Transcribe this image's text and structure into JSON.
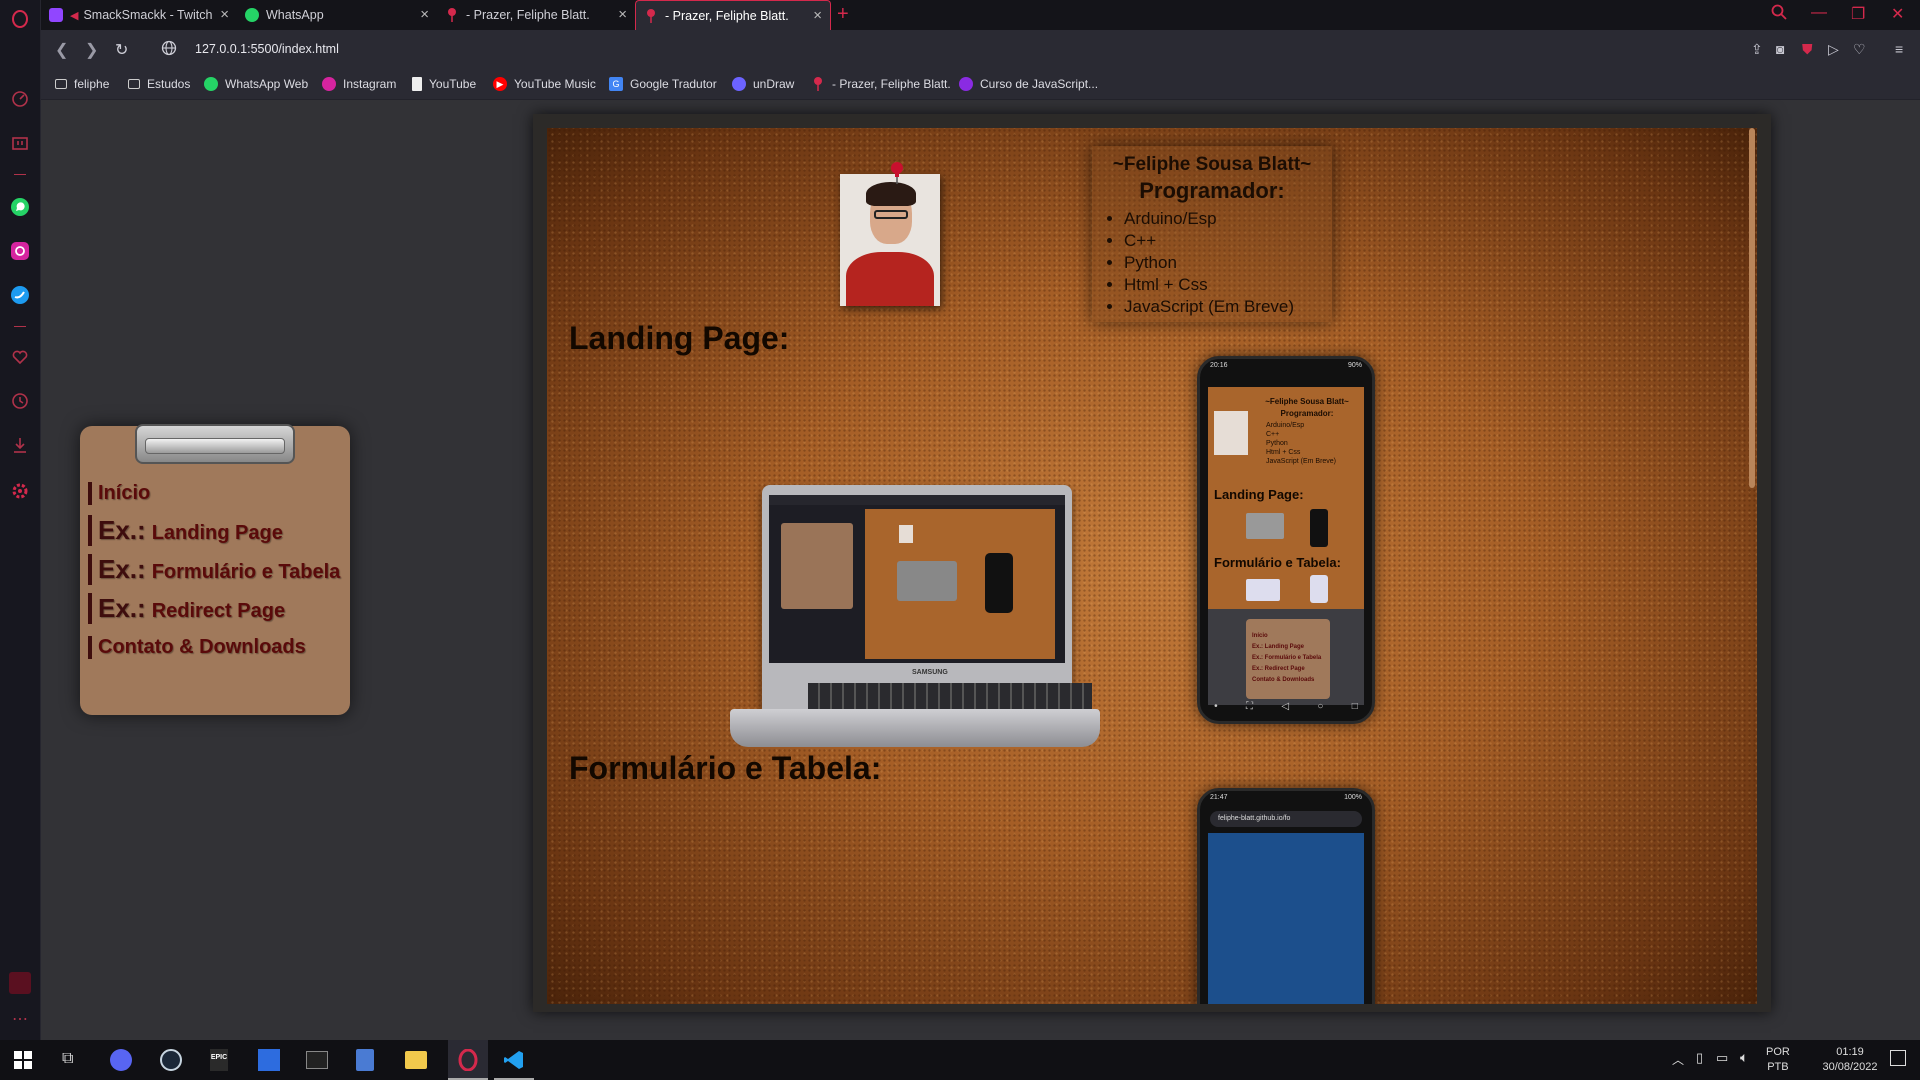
{
  "tabs": [
    {
      "title": "SmackSmackk - Twitch",
      "icon": "twitch-icon",
      "color": "#9146ff"
    },
    {
      "title": "WhatsApp",
      "icon": "whatsapp-icon",
      "color": "#25d366"
    },
    {
      "title": "- Prazer, Feliphe Blatt.",
      "icon": "pushpin-icon",
      "color": "#d4294c"
    },
    {
      "title": "- Prazer, Feliphe Blatt.",
      "icon": "pushpin-icon",
      "color": "#d4294c",
      "active": true
    }
  ],
  "address_bar": {
    "url": "127.0.0.1:5500/index.html"
  },
  "bookmarks": [
    {
      "label": "feliphe",
      "icon": "folder-icon"
    },
    {
      "label": "Estudos",
      "icon": "folder-icon"
    },
    {
      "label": "WhatsApp Web",
      "icon": "whatsapp-icon"
    },
    {
      "label": "Instagram",
      "icon": "instagram-icon"
    },
    {
      "label": "YouTube",
      "icon": "page-icon"
    },
    {
      "label": "YouTube Music",
      "icon": "youtube-music-icon"
    },
    {
      "label": "Google Tradutor",
      "icon": "google-translate-icon"
    },
    {
      "label": "unDraw",
      "icon": "undraw-icon"
    },
    {
      "label": "- Prazer, Feliphe Blatt.",
      "icon": "pushpin-icon"
    },
    {
      "label": "Curso de JavaScript...",
      "icon": "course-icon"
    }
  ],
  "clipboard_menu": {
    "items": [
      {
        "prefix": "",
        "label": "Início"
      },
      {
        "prefix": "Ex.:",
        "label": "Landing Page"
      },
      {
        "prefix": "Ex.:",
        "label": "Formulário e Tabela"
      },
      {
        "prefix": "Ex.:",
        "label": "Redirect Page"
      },
      {
        "prefix": "",
        "label": "Contato & Downloads"
      }
    ]
  },
  "bio": {
    "name": "~Feliphe Sousa Blatt~",
    "role": "Programador:",
    "skills": [
      "Arduino/Esp",
      "C++",
      "Python",
      "Html + Css",
      "JavaScript (Em Breve)"
    ]
  },
  "sections": {
    "landing": "Landing Page:",
    "form_table": "Formulário e Tabela:"
  },
  "laptop": {
    "brand": "SAMSUNG"
  },
  "phone_preview": {
    "status_time": "20:16",
    "status_battery": "90%",
    "name": "~Feliphe Sousa Blatt~",
    "role": "Programador:",
    "skills": [
      "Arduino/Esp",
      "C++",
      "Python",
      "Html + Css",
      "JavaScript (Em Breve)"
    ],
    "landing": "Landing Page:",
    "form_table": "Formulário e Tabela:",
    "menu": [
      "Início",
      "Ex.: Landing Page",
      "Ex.: Formulário e Tabela",
      "Ex.: Redirect Page",
      "Contato & Downloads"
    ]
  },
  "phone2": {
    "status_time": "21:47",
    "status_battery": "100%",
    "url": "feliphe-blatt.github.io/fo"
  },
  "taskbar": {
    "language": "POR",
    "layout": "PTB",
    "time": "01:19",
    "date": "30/08/2022"
  },
  "colors": {
    "accent": "#d4294c",
    "cork": "#a55e26",
    "clipboard": "#a0795b",
    "menu_text": "#5a0a0a"
  }
}
